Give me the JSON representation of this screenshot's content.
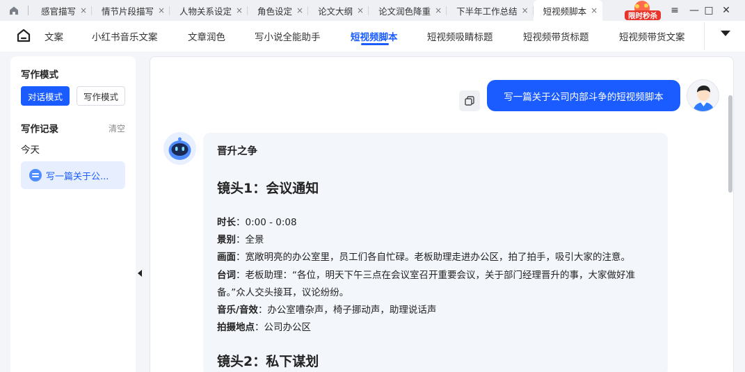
{
  "tabs": [
    {
      "label": "感官描写",
      "close": "×"
    },
    {
      "label": "情节片段描写",
      "close": "×"
    },
    {
      "label": "人物关系设定",
      "close": "×"
    },
    {
      "label": "角色设定",
      "close": "×"
    },
    {
      "label": "论文大纲",
      "close": "×"
    },
    {
      "label": "论文润色降重",
      "close": "×"
    },
    {
      "label": "下半年工作总结",
      "close": "×"
    },
    {
      "label": "短视频脚本",
      "close": "×"
    }
  ],
  "promo": {
    "text": "限时秒杀"
  },
  "window": {
    "menu": "≡",
    "minimize": "—",
    "maximize": "□",
    "close": "✕"
  },
  "nav": {
    "items": [
      "文案",
      "小红书音乐文案",
      "文章润色",
      "写小说全能助手",
      "短视频脚本",
      "短视频吸睛标题",
      "短视频带货标题",
      "短视频带货文案"
    ],
    "active_index": 4
  },
  "sidebar": {
    "mode_title": "写作模式",
    "mode_chat": "对话模式",
    "mode_write": "写作模式",
    "records_title": "写作记录",
    "clear": "清空",
    "today": "今天",
    "record_item": "写一篇关于公..."
  },
  "chat": {
    "user_message": "写一篇关于公司内部斗争的短视频脚本",
    "bot": {
      "title": "晋升之争",
      "shot1": {
        "heading": "镜头1：会议通知",
        "duration_label": "时长",
        "duration": "：0:00 - 0:08",
        "scene_label": "景别",
        "scene": "：全景",
        "visual_label": "画面",
        "visual": "：宽敞明亮的办公室里，员工们各自忙碌。老板助理走进办公区，拍了拍手，吸引大家的注意。",
        "line_label": "台词",
        "line1": "：老板助理：“各位，明天下午三点在会议室召开重要会议，关于部门经理晋升的事，大家做好准",
        "line2": "备。”众人交头接耳，议论纷纷。",
        "audio_label": "音乐/音效",
        "audio": "：办公室嘈杂声，椅子挪动声，助理说话声",
        "location_label": "拍摄地点",
        "location": "：公司办公区"
      },
      "shot2": {
        "heading": "镜头2：私下谋划"
      }
    }
  }
}
